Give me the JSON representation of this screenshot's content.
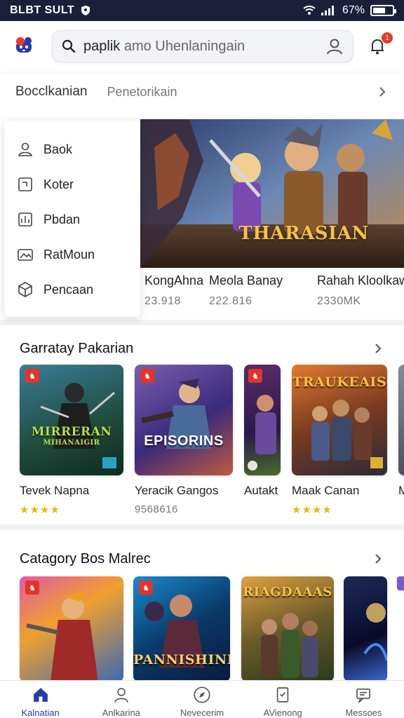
{
  "status_bar": {
    "carrier": "BLBT SULT",
    "battery": "67%",
    "battery_level": 0.67
  },
  "app_bar": {
    "logo_icon": "game-logo-icon",
    "search": {
      "query": "paplik",
      "placeholder": "amo Uhenlaningain"
    },
    "notification_count": "1",
    "accent_color": "#2b3aa8"
  },
  "category_tabs": {
    "active": "Bocclkanian",
    "second": "Penetorikain"
  },
  "side_menu": {
    "items": [
      {
        "label": "Baok",
        "icon": "user-icon"
      },
      {
        "label": "Koter",
        "icon": "tag-icon"
      },
      {
        "label": "Pbdan",
        "icon": "chart-icon"
      },
      {
        "label": "RatMoun",
        "icon": "image-icon"
      },
      {
        "label": "Pencaan",
        "icon": "box-icon"
      }
    ]
  },
  "hero": {
    "banner_title": "THARASIAN",
    "items": [
      {
        "title": "KongAhna",
        "sub": "23.918"
      },
      {
        "title": "Meola Banay",
        "sub": "222.816"
      },
      {
        "title": "Rahah Kloolkaw",
        "sub": "2330MK"
      }
    ]
  },
  "section1": {
    "title": "Garratay Pakarian",
    "cards": [
      {
        "name": "Tevek Napna",
        "stars": "★★★★",
        "thumb_title": "MIRRERAN",
        "thumb_sub": "MIHANAIGIR"
      },
      {
        "name": "Yeracik Gangos",
        "sub": "9568616",
        "thumb_title": "EPISORINS"
      },
      {
        "name": "Autakt",
        "thumb_title": ""
      },
      {
        "name": "Maak Canan",
        "stars": "★★★★",
        "thumb_title": "TRAUKEAIS"
      },
      {
        "name": "M",
        "thumb_title": ""
      }
    ]
  },
  "section2": {
    "title": "Catagory Bos Malrec",
    "cards": [
      {
        "thumb_title": ""
      },
      {
        "thumb_title": "PANNISHINE"
      },
      {
        "thumb_title": "RIAGDAAAS"
      },
      {
        "thumb_title": ""
      }
    ]
  },
  "bottom_nav": {
    "items": [
      {
        "label": "Kalnatian",
        "icon": "home-icon",
        "active": true
      },
      {
        "label": "Anlkarina",
        "icon": "profile-icon",
        "active": false
      },
      {
        "label": "Nevecerim",
        "icon": "compass-icon",
        "active": false
      },
      {
        "label": "AVienong",
        "icon": "document-icon",
        "active": false
      },
      {
        "label": "Messoes",
        "icon": "messages-icon",
        "active": false
      }
    ]
  }
}
